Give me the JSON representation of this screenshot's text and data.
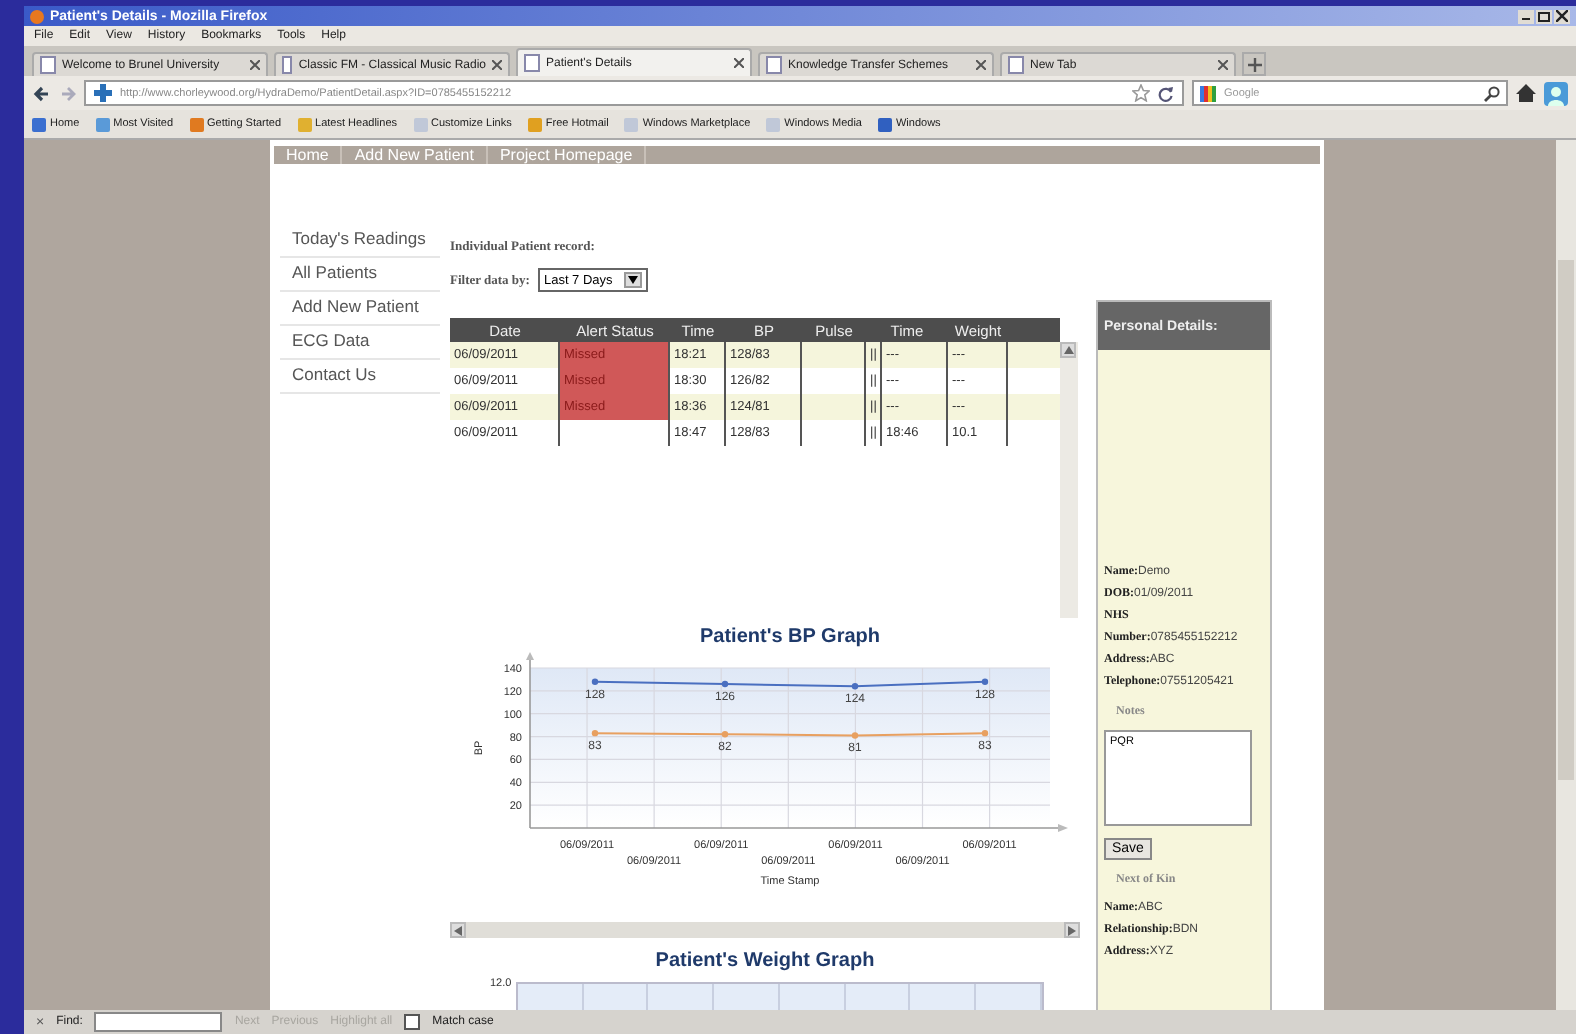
{
  "window": {
    "title": "Patient's Details - Mozilla Firefox"
  },
  "menu": [
    "File",
    "Edit",
    "View",
    "History",
    "Bookmarks",
    "Tools",
    "Help"
  ],
  "tabs": [
    {
      "label": "Welcome to Brunel University",
      "selected": false
    },
    {
      "label": "Classic FM - Classical Music Radio",
      "selected": false
    },
    {
      "label": "Patient's Details",
      "selected": true
    },
    {
      "label": "Knowledge Transfer Schemes",
      "selected": false
    },
    {
      "label": "New Tab",
      "selected": false
    }
  ],
  "address_bar": {
    "url": "http://www.chorleywood.org/HydraDemo/PatientDetail.aspx?ID=0785455152212"
  },
  "search": {
    "placeholder": "Google"
  },
  "bookmarks": [
    "Home",
    "Most Visited",
    "Getting Started",
    "Latest Headlines",
    "Customize Links",
    "Free Hotmail",
    "Windows Marketplace",
    "Windows Media",
    "Windows"
  ],
  "page": {
    "nav": [
      "Home",
      "Add New Patient",
      "Project Homepage"
    ],
    "sidebar": {
      "items": [
        "Today's Readings",
        "All Patients",
        "Add New Patient",
        "ECG Data",
        "Contact Us"
      ]
    },
    "record_label": "Individual Patient record:",
    "filter": {
      "label": "Filter data by:",
      "value": "Last 7 Days"
    },
    "table": {
      "columns": [
        "Date",
        "Alert Status",
        "Time",
        "BP",
        "Pulse",
        "Time",
        "Weight"
      ],
      "rows": [
        {
          "date": "06/09/2011",
          "alert": "Missed",
          "missed": true,
          "time": "18:21",
          "bp": "128/83",
          "column_6": "||",
          "time_2": "---",
          "weight": "---"
        },
        {
          "date": "06/09/2011",
          "alert": "Missed",
          "missed": true,
          "time": "18:30",
          "bp": "126/82",
          "column_6": "||",
          "time_2": "---",
          "weight": "---"
        },
        {
          "date": "06/09/2011",
          "alert": "Missed",
          "missed": true,
          "time": "18:36",
          "bp": "124/81",
          "column_6": "||",
          "time_2": "---",
          "weight": "---"
        },
        {
          "date": "06/09/2011",
          "missed": false,
          "time": "18:47",
          "bp": "128/83",
          "column_6": "||",
          "time_2": "18:46",
          "weight": "10.1"
        }
      ]
    },
    "bp_graph": {
      "x_axis_labels": [
        "06/09/2011",
        "06/09/2011",
        "06/09/2011",
        "06/09/2011",
        "06/09/2011",
        "06/09/2011",
        "06/09/2011"
      ],
      "chart_data": {
        "type": "line",
        "title": "Patient's BP Graph",
        "xlabel": "Time Stamp",
        "ylabel": "BP",
        "categories": [
          null,
          null,
          null,
          null
        ],
        "series": [
          {
            "color": "#4a6fc0",
            "marker": "o",
            "values": [
              128,
              126,
              124,
              128
            ]
          },
          {
            "color": "#e8a060",
            "marker": "o",
            "values": [
              83,
              82,
              81,
              83
            ]
          }
        ],
        "ylim": [
          0,
          140
        ],
        "yticks": [
          20,
          40,
          60,
          80,
          100,
          120,
          140
        ],
        "grid": true,
        "data_labels": true
      }
    },
    "weight_graph": {
      "title": "Patient's Weight Graph",
      "ytick": "12.0"
    },
    "personal_details": {
      "header": "Personal Details:",
      "fields": [
        {
          "label": "Name:",
          "value": "Demo"
        },
        {
          "label": "DOB:",
          "value": "01/09/2011"
        },
        {
          "label": "NHS Number:",
          "value": "0785455152212"
        },
        {
          "label": "Address:",
          "value": "ABC"
        },
        {
          "label": "Telephone:",
          "value": "07551205421"
        }
      ],
      "notes": {
        "label": "Notes",
        "value": "PQR"
      },
      "save": "Save",
      "kin_label": "Next of Kin",
      "kin": [
        {
          "label": "Name:",
          "value": "ABC"
        },
        {
          "label": "Relationship:",
          "value": "BDN"
        },
        {
          "label": "Address:",
          "value": "XYZ"
        }
      ]
    }
  },
  "find_bar": {
    "close": "×",
    "label": "Find:",
    "next": "Next",
    "previous": "Previous",
    "highlight": "Highlight all",
    "disabled": true,
    "match_case": {
      "label": "Match case",
      "checked": false
    }
  }
}
